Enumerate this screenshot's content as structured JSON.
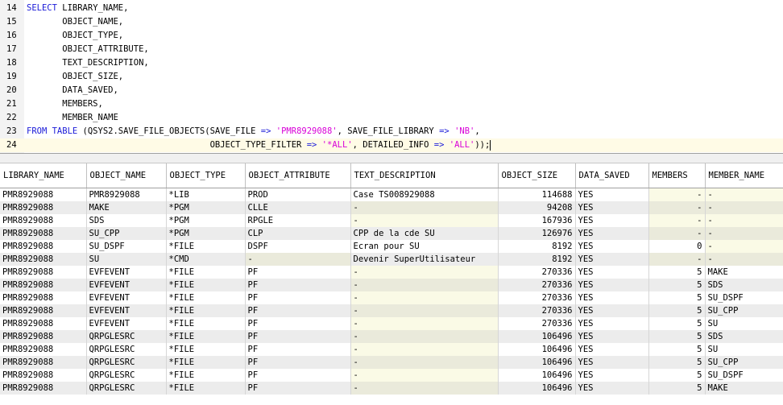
{
  "editor": {
    "lines": [
      {
        "num": "14",
        "parts": [
          [
            "kw",
            "SELECT"
          ],
          [
            "t",
            " LIBRARY_NAME,"
          ]
        ]
      },
      {
        "num": "15",
        "parts": [
          [
            "t",
            "       OBJECT_NAME,"
          ]
        ]
      },
      {
        "num": "16",
        "parts": [
          [
            "t",
            "       OBJECT_TYPE,"
          ]
        ]
      },
      {
        "num": "17",
        "parts": [
          [
            "t",
            "       OBJECT_ATTRIBUTE,"
          ]
        ]
      },
      {
        "num": "18",
        "parts": [
          [
            "t",
            "       TEXT_DESCRIPTION,"
          ]
        ]
      },
      {
        "num": "19",
        "parts": [
          [
            "t",
            "       OBJECT_SIZE,"
          ]
        ]
      },
      {
        "num": "20",
        "parts": [
          [
            "t",
            "       DATA_SAVED,"
          ]
        ]
      },
      {
        "num": "21",
        "parts": [
          [
            "t",
            "       MEMBERS,"
          ]
        ]
      },
      {
        "num": "22",
        "parts": [
          [
            "t",
            "       MEMBER_NAME"
          ]
        ]
      },
      {
        "num": "23",
        "parts": [
          [
            "kw",
            "FROM TABLE"
          ],
          [
            "t",
            " (QSYS2.SAVE_FILE_OBJECTS(SAVE_FILE "
          ],
          [
            "op",
            "=>"
          ],
          [
            "t",
            " "
          ],
          [
            "str",
            "'PMR8929088'"
          ],
          [
            "t",
            ", SAVE_FILE_LIBRARY "
          ],
          [
            "op",
            "=>"
          ],
          [
            "t",
            " "
          ],
          [
            "str",
            "'NB'"
          ],
          [
            "t",
            ","
          ]
        ]
      },
      {
        "num": "24",
        "parts": [
          [
            "t",
            "                                    OBJECT_TYPE_FILTER "
          ],
          [
            "op",
            "=>"
          ],
          [
            "t",
            " "
          ],
          [
            "str",
            "'*ALL'"
          ],
          [
            "t",
            ", DETAILED_INFO "
          ],
          [
            "op",
            "=>"
          ],
          [
            "t",
            " "
          ],
          [
            "str",
            "'ALL'"
          ],
          [
            "t",
            "));"
          ]
        ]
      }
    ]
  },
  "grid": {
    "columns": [
      "LIBRARY_NAME",
      "OBJECT_NAME",
      "OBJECT_TYPE",
      "OBJECT_ATTRIBUTE",
      "TEXT_DESCRIPTION",
      "OBJECT_SIZE",
      "DATA_SAVED",
      "MEMBERS",
      "MEMBER_NAME"
    ],
    "rows": [
      [
        "PMR8929088",
        "PMR8929088",
        "*LIB",
        "PROD",
        "Case TS008929088",
        "114688",
        "YES",
        "-",
        "-"
      ],
      [
        "PMR8929088",
        "MAKE",
        "*PGM",
        "CLLE",
        "-",
        "94208",
        "YES",
        "-",
        "-"
      ],
      [
        "PMR8929088",
        "SDS",
        "*PGM",
        "RPGLE",
        "-",
        "167936",
        "YES",
        "-",
        "-"
      ],
      [
        "PMR8929088",
        "SU_CPP",
        "*PGM",
        "CLP",
        "CPP de la cde SU",
        "126976",
        "YES",
        "-",
        "-"
      ],
      [
        "PMR8929088",
        "SU_DSPF",
        "*FILE",
        "DSPF",
        "Ecran pour SU",
        "8192",
        "YES",
        "0",
        "-"
      ],
      [
        "PMR8929088",
        "SU",
        "*CMD",
        "-",
        "Devenir SuperUtilisateur",
        "8192",
        "YES",
        "-",
        "-"
      ],
      [
        "PMR8929088",
        "EVFEVENT",
        "*FILE",
        "PF",
        "-",
        "270336",
        "YES",
        "5",
        "MAKE"
      ],
      [
        "PMR8929088",
        "EVFEVENT",
        "*FILE",
        "PF",
        "-",
        "270336",
        "YES",
        "5",
        "SDS"
      ],
      [
        "PMR8929088",
        "EVFEVENT",
        "*FILE",
        "PF",
        "-",
        "270336",
        "YES",
        "5",
        "SU_DSPF"
      ],
      [
        "PMR8929088",
        "EVFEVENT",
        "*FILE",
        "PF",
        "-",
        "270336",
        "YES",
        "5",
        "SU_CPP"
      ],
      [
        "PMR8929088",
        "EVFEVENT",
        "*FILE",
        "PF",
        "-",
        "270336",
        "YES",
        "5",
        "SU"
      ],
      [
        "PMR8929088",
        "QRPGLESRC",
        "*FILE",
        "PF",
        "-",
        "106496",
        "YES",
        "5",
        "SDS"
      ],
      [
        "PMR8929088",
        "QRPGLESRC",
        "*FILE",
        "PF",
        "-",
        "106496",
        "YES",
        "5",
        "SU"
      ],
      [
        "PMR8929088",
        "QRPGLESRC",
        "*FILE",
        "PF",
        "-",
        "106496",
        "YES",
        "5",
        "SU_CPP"
      ],
      [
        "PMR8929088",
        "QRPGLESRC",
        "*FILE",
        "PF",
        "-",
        "106496",
        "YES",
        "5",
        "SU_DSPF"
      ],
      [
        "PMR8929088",
        "QRPGLESRC",
        "*FILE",
        "PF",
        "-",
        "106496",
        "YES",
        "5",
        "MAKE"
      ]
    ]
  }
}
